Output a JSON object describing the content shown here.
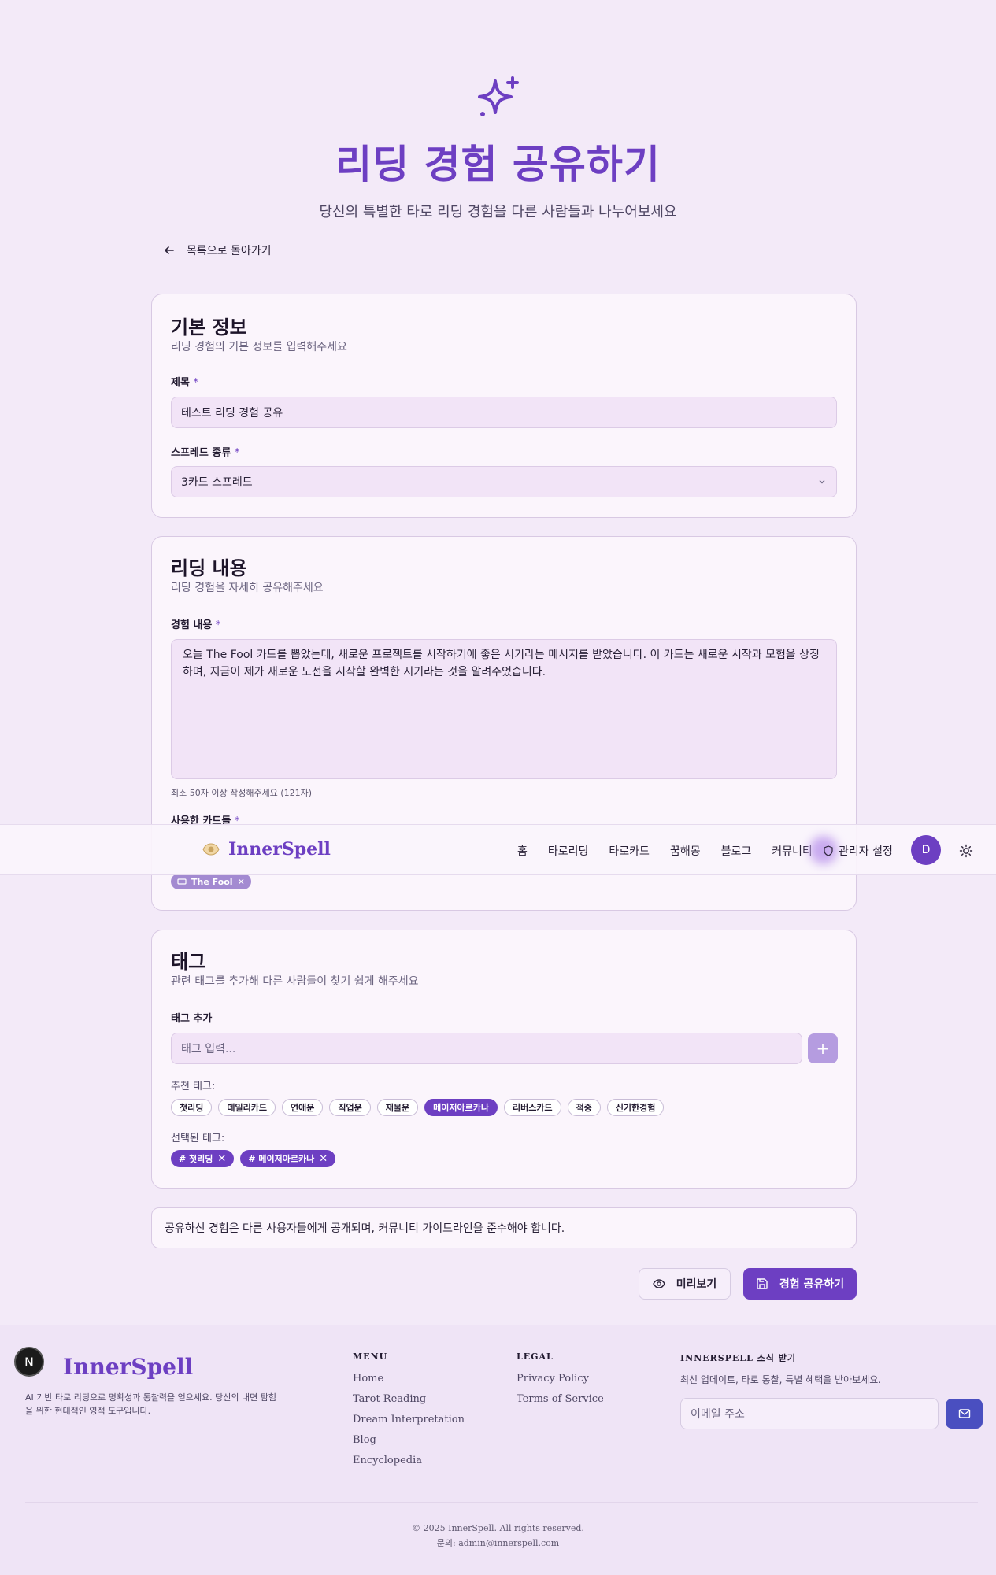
{
  "hero": {
    "title": "리딩 경험 공유하기",
    "subtitle": "당신의 특별한 타로 리딩 경험을 다른 사람들과 나누어보세요"
  },
  "back_label": "목록으로 돌아가기",
  "basic": {
    "heading": "기본 정보",
    "description": "리딩 경험의 기본 정보를 입력해주세요",
    "title_label": "제목",
    "title_value": "테스트 리딩 경험 공유",
    "spread_label": "스프레드 종류",
    "spread_value": "3카드 스프레드",
    "required_mark": "*"
  },
  "content": {
    "heading": "리딩 내용",
    "description": "리딩 경험을 자세히 공유해주세요",
    "experience_label": "경험 내용",
    "experience_value": "오늘 The Fool 카드를 뽑았는데, 새로운 프로젝트를 시작하기에 좋은 시기라는 메시지를 받았습니다. 이 카드는 새로운 시작과 모험을 상징하며, 지금이 제가 새로운 도전을 시작할 완벽한 시기라는 것을 알려주었습니다.",
    "hint": "최소 50자 이상 작성해주세요 (121자)",
    "cards_label": "사용한 카드들",
    "selected_card": "The Fool"
  },
  "tags": {
    "heading": "태그",
    "description": "관련 태그를 추가해 다른 사람들이 찾기 쉽게 해주세요",
    "add_label": "태그 추가",
    "input_placeholder": "태그 입력...",
    "add_button": "+",
    "recommended_label": "추천 태그:",
    "recommended": [
      "첫리딩",
      "데일리카드",
      "연애운",
      "직업운",
      "재물운",
      "메이저아르카나",
      "리버스카드",
      "적중",
      "신기한경험"
    ],
    "active_recommended": "메이저아르카나",
    "selected_label": "선택된 태그:",
    "selected": [
      "# 첫리딩",
      "# 메이저아르카나"
    ]
  },
  "notice": "공유하신 경험은 다른 사용자들에게 공개되며, 커뮤니티 가이드라인을 준수해야 합니다.",
  "actions": {
    "preview": "미리보기",
    "share": "경험 공유하기"
  },
  "navbar": {
    "brand": "InnerSpell",
    "links": [
      "홈",
      "타로리딩",
      "타로카드",
      "꿈해몽",
      "블로그",
      "커뮤니티"
    ],
    "admin": "관리자 설정",
    "avatar": "D"
  },
  "footer": {
    "badge": "N",
    "brand": "InnerSpell",
    "tagline": "AI 기반 타로 리딩으로 명확성과 통찰력을 얻으세요. 당신의 내면 탐험을 위한 현대적인 영적 도구입니다.",
    "menu_heading": "MENU",
    "menu": [
      "Home",
      "Tarot Reading",
      "Dream Interpretation",
      "Blog",
      "Encyclopedia"
    ],
    "legal_heading": "LEGAL",
    "legal": [
      "Privacy Policy",
      "Terms of Service"
    ],
    "news_heading": "INNERSPELL 소식 받기",
    "news_description": "최신 업데이트, 타로 통찰, 특별 혜택을 받아보세요.",
    "email_placeholder": "이메일 주소",
    "copyright": "© 2025 InnerSpell. All rights reserved.",
    "contact": "문의: admin@innerspell.com"
  },
  "colors": {
    "accent": "#6d3fc2",
    "background": "#f3eaf8",
    "card": "#fbf5fc"
  }
}
